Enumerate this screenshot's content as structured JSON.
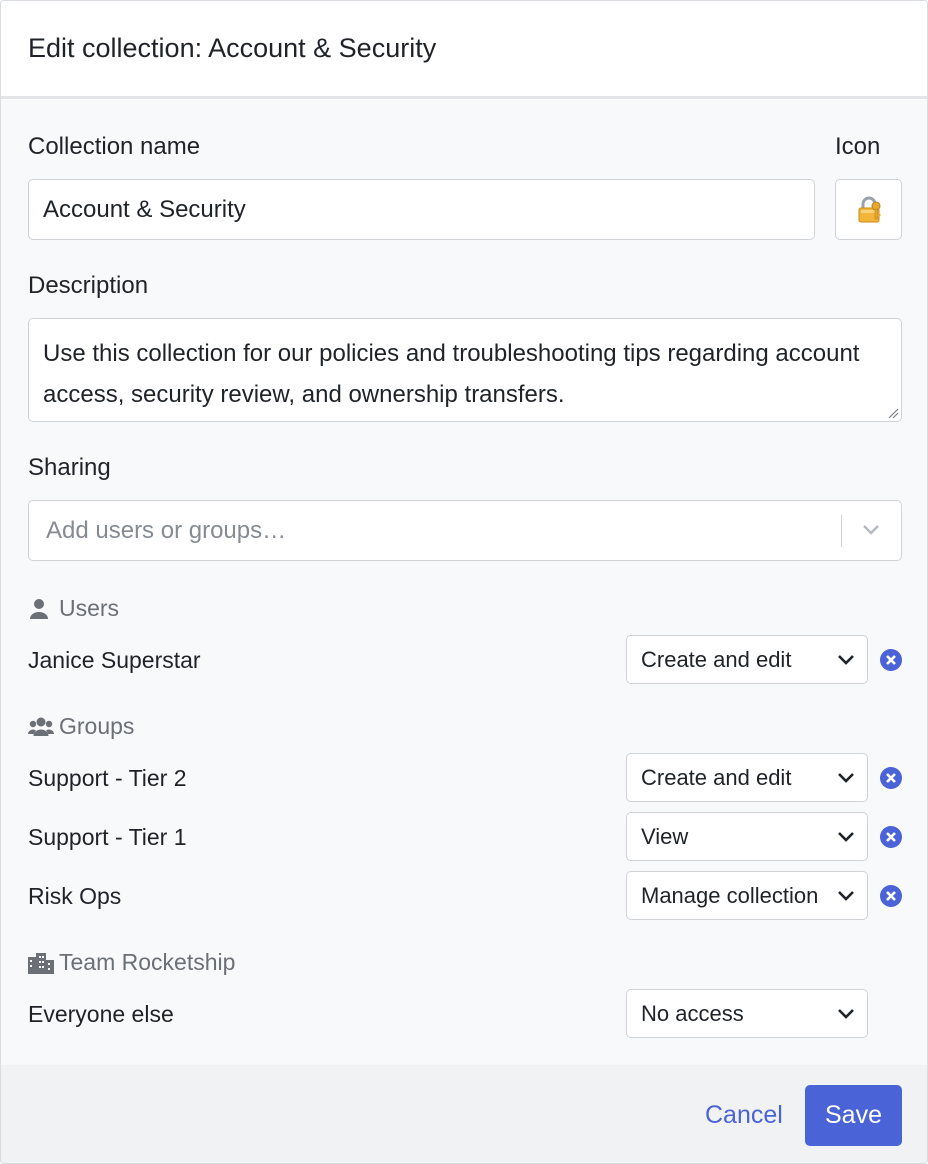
{
  "modal": {
    "title": "Edit collection: Account & Security"
  },
  "form": {
    "name_label": "Collection name",
    "name_value": "Account & Security",
    "icon_label": "Icon",
    "icon": "lock-with-key-icon",
    "description_label": "Description",
    "description_value": "Use this collection for our policies and troubleshooting tips regarding account access, security review, and ownership transfers.",
    "sharing_label": "Sharing",
    "sharing_placeholder": "Add users or groups…"
  },
  "sections": {
    "users": {
      "title": "Users",
      "icon": "user-icon",
      "rows": [
        {
          "name": "Janice Superstar",
          "permission": "Create and edit",
          "removable": true
        }
      ]
    },
    "groups": {
      "title": "Groups",
      "icon": "users-group-icon",
      "rows": [
        {
          "name": "Support - Tier 2",
          "permission": "Create and edit",
          "removable": true
        },
        {
          "name": "Support - Tier 1",
          "permission": "View",
          "removable": true
        },
        {
          "name": "Risk Ops",
          "permission": "Manage collection",
          "removable": true
        }
      ]
    },
    "team": {
      "title": "Team Rocketship",
      "icon": "building-icon",
      "rows": [
        {
          "name": "Everyone else",
          "permission": "No access",
          "removable": false
        }
      ]
    }
  },
  "footer": {
    "cancel_label": "Cancel",
    "save_label": "Save"
  },
  "colors": {
    "accent": "#4a63d6",
    "remove_icon": "#4a63d6",
    "muted_text": "#6b7077"
  }
}
